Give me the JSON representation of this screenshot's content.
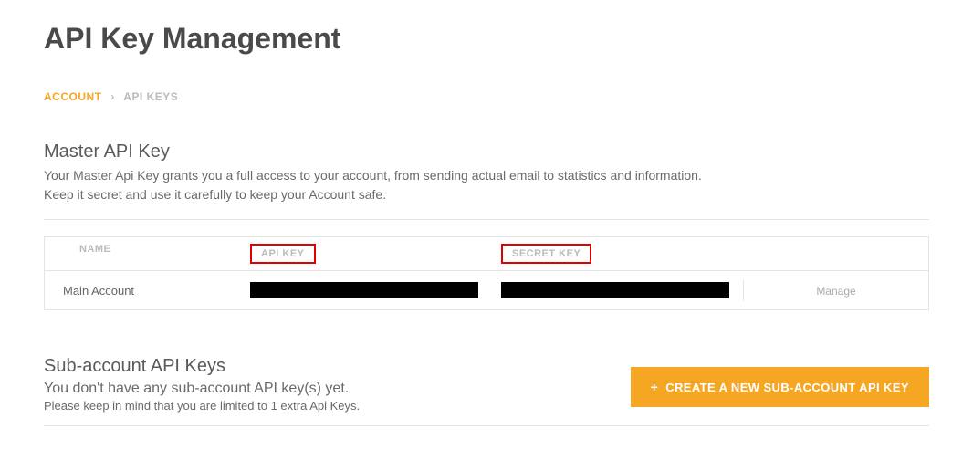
{
  "page": {
    "title": "API Key Management"
  },
  "breadcrumb": {
    "root": "ACCOUNT",
    "separator": "›",
    "current": "API KEYS"
  },
  "master": {
    "title": "Master API Key",
    "desc_line1": "Your Master Api Key grants you a full access to your account, from sending actual email to statistics and information.",
    "desc_line2": "Keep it secret and use it carefully to keep your Account safe."
  },
  "table": {
    "headers": {
      "name": "NAME",
      "api_key": "API KEY",
      "secret_key": "SECRET KEY"
    },
    "row": {
      "name": "Main Account",
      "manage": "Manage"
    }
  },
  "sub": {
    "title": "Sub-account API Keys",
    "msg": "You don't have any sub-account API key(s) yet.",
    "note": "Please keep in mind that you are limited to 1 extra Api Keys.",
    "create_btn": "CREATE A NEW SUB-ACCOUNT API KEY"
  }
}
